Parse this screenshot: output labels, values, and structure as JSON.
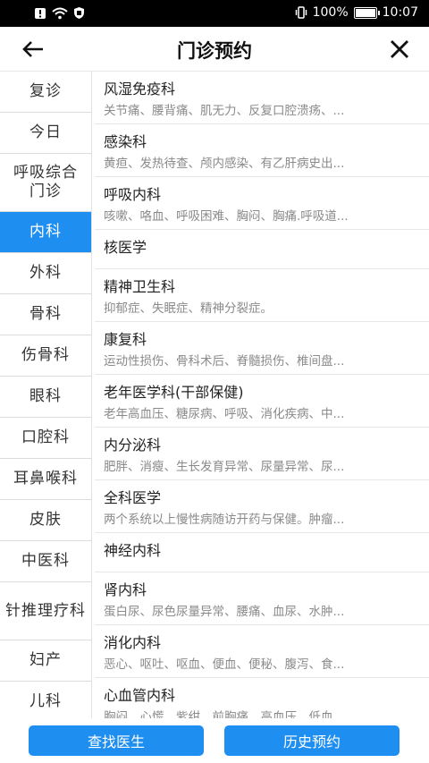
{
  "status": {
    "battery_pct_text": "100%",
    "time": "10:07",
    "battery_level": 1.0,
    "icons": [
      "notification-icon",
      "wifi-icon",
      "shield-icon",
      "vibrate-icon",
      "battery-icon"
    ]
  },
  "nav": {
    "title": "门诊预约",
    "back_icon": "arrow-left-icon",
    "close_icon": "close-icon"
  },
  "sidebar": {
    "items": [
      {
        "label": "复诊"
      },
      {
        "label": "今日"
      },
      {
        "label": "呼吸综合门诊"
      },
      {
        "label": "内科"
      },
      {
        "label": "外科"
      },
      {
        "label": "骨科"
      },
      {
        "label": "伤骨科"
      },
      {
        "label": "眼科"
      },
      {
        "label": "口腔科"
      },
      {
        "label": "耳鼻喉科"
      },
      {
        "label": "皮肤"
      },
      {
        "label": "中医科"
      },
      {
        "label": "针推理疗科"
      },
      {
        "label": "妇产"
      },
      {
        "label": "儿科"
      }
    ],
    "active_index": 3
  },
  "departments": [
    {
      "name": "风湿免疫科",
      "desc": "关节痛、腰背痛、肌无力、反复口腔溃疡、..."
    },
    {
      "name": "感染科",
      "desc": "黄疸、发热待查、颅内感染、有乙肝病史出..."
    },
    {
      "name": "呼吸内科",
      "desc": "咳嗽、咯血、呼吸困难、胸闷、胸痛.呼吸道..."
    },
    {
      "name": "核医学",
      "desc": ""
    },
    {
      "name": "精神卫生科",
      "desc": "抑郁症、失眠症、精神分裂症。"
    },
    {
      "name": "康复科",
      "desc": "运动性损伤、骨科术后、脊髓损伤、椎间盘..."
    },
    {
      "name": "老年医学科(干部保健)",
      "desc": "老年高血压、糖尿病、呼吸、消化疾病、中..."
    },
    {
      "name": "内分泌科",
      "desc": "肥胖、消瘦、生长发育异常、尿量异常、尿..."
    },
    {
      "name": "全科医学",
      "desc": "两个系统以上慢性病随访开药与保健。肿瘤..."
    },
    {
      "name": "神经内科",
      "desc": ""
    },
    {
      "name": "肾内科",
      "desc": "蛋白尿、尿色尿量异常、腰痛、血尿、水肿..."
    },
    {
      "name": "消化内科",
      "desc": "恶心、呕吐、呕血、便血、便秘、腹泻、食..."
    },
    {
      "name": "心血管内科",
      "desc": "胸闷、心慌、紫绀、前胸痛、高血压、低血..."
    }
  ],
  "buttons": {
    "find_doctor": "查找医生",
    "history": "历史预约"
  },
  "colors": {
    "accent": "#1f8ef1",
    "status_bar": "#000000"
  }
}
